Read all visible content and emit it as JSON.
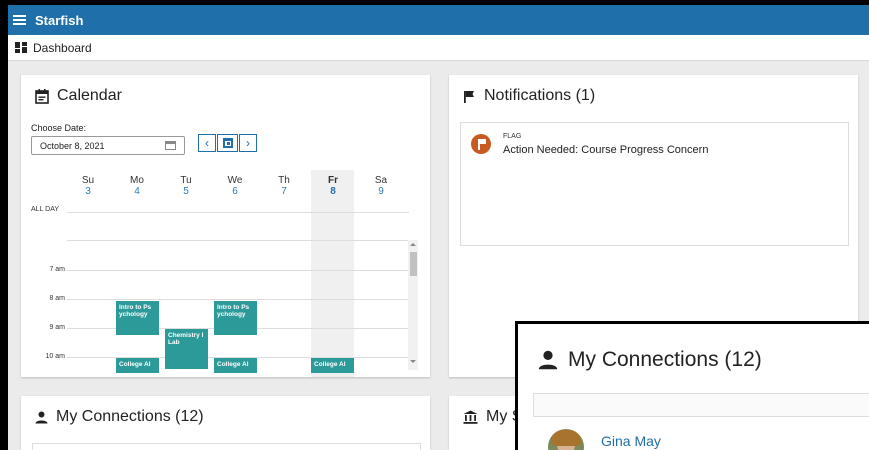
{
  "app": {
    "title": "Starfish"
  },
  "breadcrumb": {
    "label": "Dashboard"
  },
  "calendar": {
    "title": "Calendar",
    "choose_date_label": "Choose Date:",
    "date_value": "October 8, 2021",
    "days": [
      {
        "name": "Su",
        "num": "3"
      },
      {
        "name": "Mo",
        "num": "4"
      },
      {
        "name": "Tu",
        "num": "5"
      },
      {
        "name": "We",
        "num": "6"
      },
      {
        "name": "Th",
        "num": "7"
      },
      {
        "name": "Fr",
        "num": "8"
      },
      {
        "name": "Sa",
        "num": "9"
      }
    ],
    "all_day_label": "ALL DAY",
    "hours": [
      "7 am",
      "8 am",
      "9 am",
      "10 am"
    ],
    "events": [
      {
        "title": "Intro to Ps ychology"
      },
      {
        "title": "Chemistry I Lab"
      },
      {
        "title": "Intro to Ps ychology"
      },
      {
        "title": "College Al"
      },
      {
        "title": "College Al"
      },
      {
        "title": "College Al"
      }
    ]
  },
  "notifications": {
    "title": "Notifications (1)",
    "items": [
      {
        "type": "FLAG",
        "text": "Action Needed: Course Progress Concern"
      }
    ]
  },
  "connections": {
    "title": "My Connections (12)"
  },
  "my_s": {
    "title": "My S"
  },
  "zoom": {
    "title": "My Connections (12)",
    "first_name": "Gina May"
  },
  "colors": {
    "header": "#1f6fab",
    "event": "#2b9a98",
    "flag": "#c85a21",
    "link": "#1f6fab"
  }
}
